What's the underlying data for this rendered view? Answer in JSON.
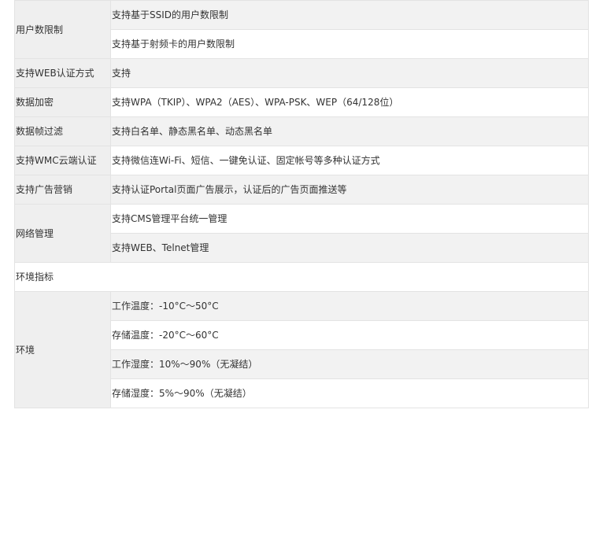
{
  "rows": [
    {
      "label": "用户数限制",
      "values": [
        "支持基于SSID的用户数限制",
        "支持基于射频卡的用户数限制"
      ]
    },
    {
      "label": "支持WEB认证方式",
      "values": [
        "支持"
      ]
    },
    {
      "label": "数据加密",
      "values": [
        "支持WPA（TKIP）、WPA2（AES）、WPA-PSK、WEP（64/128位）"
      ]
    },
    {
      "label": "数据帧过滤",
      "values": [
        "支持白名单、静态黑名单、动态黑名单"
      ]
    },
    {
      "label": "支持WMC云端认证",
      "values": [
        "支持微信连Wi-Fi、短信、一键免认证、固定帐号等多种认证方式"
      ]
    },
    {
      "label": "支持广告营销",
      "values": [
        "支持认证Portal页面广告展示，认证后的广告页面推送等"
      ]
    },
    {
      "label": "网络管理",
      "values": [
        "支持CMS管理平台统一管理",
        "支持WEB、Telnet管理"
      ]
    }
  ],
  "section_heading": "环境指标",
  "environment": {
    "label": "环境",
    "values": [
      "工作温度：-10°C～50°C",
      "存储温度：-20°C～60°C",
      "工作湿度：10%～90%（无凝结）",
      "存储湿度：5%～90%（无凝结）"
    ]
  }
}
